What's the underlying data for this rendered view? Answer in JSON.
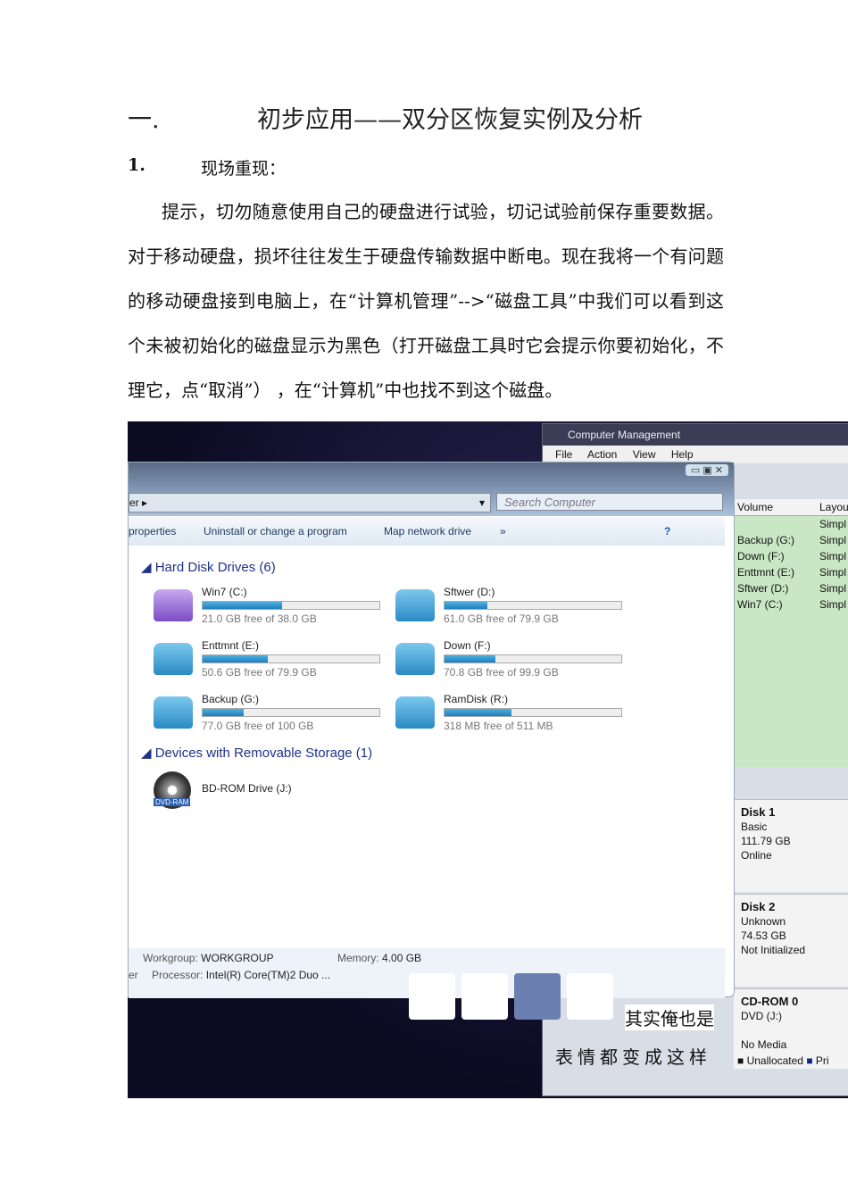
{
  "heading": {
    "number": "一.",
    "title": "初步应用——双分区恢复实例及分析"
  },
  "subheading": {
    "number": "1.",
    "title": "现场重现："
  },
  "paragraph": "提示，切勿随意使用自己的硬盘进行试验，切记试验前保存重要数据。对于移动硬盘，损坏往往发生于硬盘传输数据中断电。现在我将一个有问题的移动硬盘接到电脑上，在“计算机管理”-->“磁盘工具”中我们可以看到这个未被初始化的磁盘显示为黑色（打开磁盘工具时它会提示你要初始化，不理它，点“取消”） ，在“计算机”中也找不到这个磁盘。",
  "screenshot": {
    "cm": {
      "title": "Computer Management",
      "menu": "File Action View Help",
      "volume_header": [
        "Volume",
        "Layou"
      ],
      "volumes": [
        [
          "",
          "Simpl"
        ],
        [
          "Backup (G:)",
          "Simpl"
        ],
        [
          "Down (F:)",
          "Simpl"
        ],
        [
          "Enttmnt (E:)",
          "Simpl"
        ],
        [
          "Sftwer (D:)",
          "Simpl"
        ],
        [
          "Win7 (C:)",
          "Simpl"
        ]
      ],
      "disks": [
        {
          "name": "Disk 1",
          "l1": "Basic",
          "l2": "111.79 GB",
          "l3": "Online"
        },
        {
          "name": "Disk 2",
          "l1": "Unknown",
          "l2": "74.53 GB",
          "l3": "Not Initialized"
        },
        {
          "name": "CD-ROM 0",
          "l1": "DVD (J:)",
          "l2": "",
          "l3": "No Media"
        }
      ],
      "legend": [
        "Unallocated",
        "Pri"
      ]
    },
    "explorer": {
      "address": "er ▸",
      "search_placeholder": "Search Computer",
      "toolbar": [
        "properties",
        "Uninstall or change a program",
        "Map network drive",
        "»"
      ],
      "group1": "Hard Disk Drives (6)",
      "drives": [
        {
          "name": "Win7 (C:)",
          "free": "21.0 GB free of 38.0 GB",
          "used_pct": 45
        },
        {
          "name": "Sftwer (D:)",
          "free": "61.0 GB free of 79.9 GB",
          "used_pct": 24
        },
        {
          "name": "Enttmnt (E:)",
          "free": "50.6 GB free of 79.9 GB",
          "used_pct": 37
        },
        {
          "name": "Down (F:)",
          "free": "70.8 GB free of 99.9 GB",
          "used_pct": 29
        },
        {
          "name": "Backup (G:)",
          "free": "77.0 GB free of 100 GB",
          "used_pct": 23
        },
        {
          "name": "RamDisk (R:)",
          "free": "318 MB free of 511 MB",
          "used_pct": 38
        }
      ],
      "group2": "Devices with Removable Storage (1)",
      "removable": "BD-ROM Drive (J:)",
      "dvd_badge": "DVD-RAM",
      "footer": {
        "wg_label": "Workgroup:",
        "wg": "WORKGROUP",
        "mem_label": "Memory:",
        "mem": "4.00 GB",
        "left": "er",
        "proc_label": "Processor:",
        "proc": "Intel(R) Core(TM)2 Duo ..."
      }
    },
    "caption1": "其实俺也是",
    "caption2": "表情都变成这样"
  }
}
